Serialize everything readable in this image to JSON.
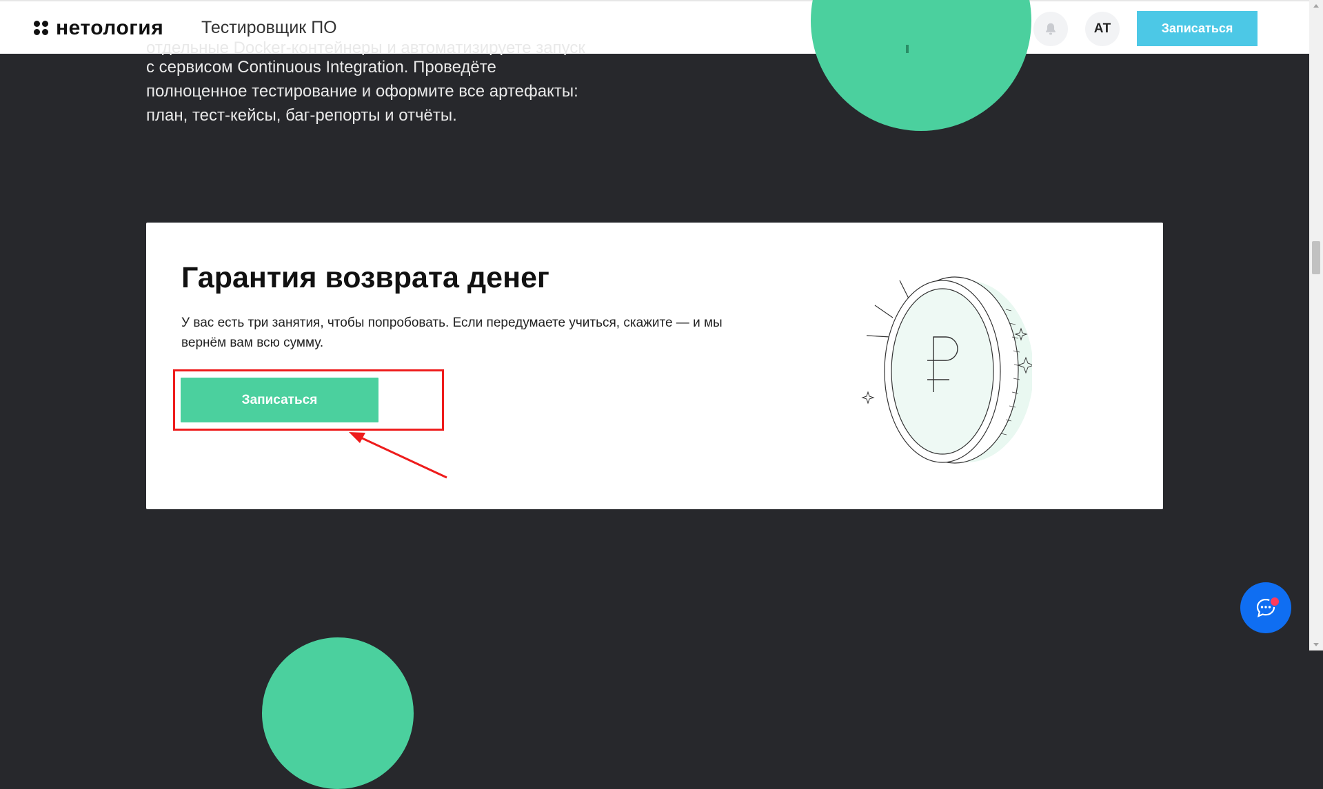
{
  "header": {
    "logo_text": "нетология",
    "course_title": "Тестировщик ПО",
    "avatar_initials": "АТ",
    "cta_label": "Записаться"
  },
  "intro": {
    "line_partial": "отдельные Docker-контейнеры и автоматизируете запуск",
    "line_1": "с сервисом Continuous Integration. Проведёте",
    "line_2": "полноценное тестирование и оформите все  артефакты:",
    "line_3": "план, тест-кейсы, баг-репорты и отчёты."
  },
  "guarantee": {
    "title": "Гарантия возврата денег",
    "text": "У вас есть три занятия, чтобы попробовать. Если передумаете учиться, скажите — и мы вернём вам всю сумму.",
    "cta_label": "Записаться"
  },
  "colors": {
    "background": "#27282c",
    "accent_green": "#4bd09e",
    "header_cta": "#4cc8e6",
    "chat_blue": "#0f6ef2",
    "highlight_red": "#ee1c1c"
  },
  "icons": {
    "bell": "bell-icon",
    "chat": "chat-icon",
    "coin": "ruble-coin-illustration",
    "logo": "netology-logo-mark"
  }
}
